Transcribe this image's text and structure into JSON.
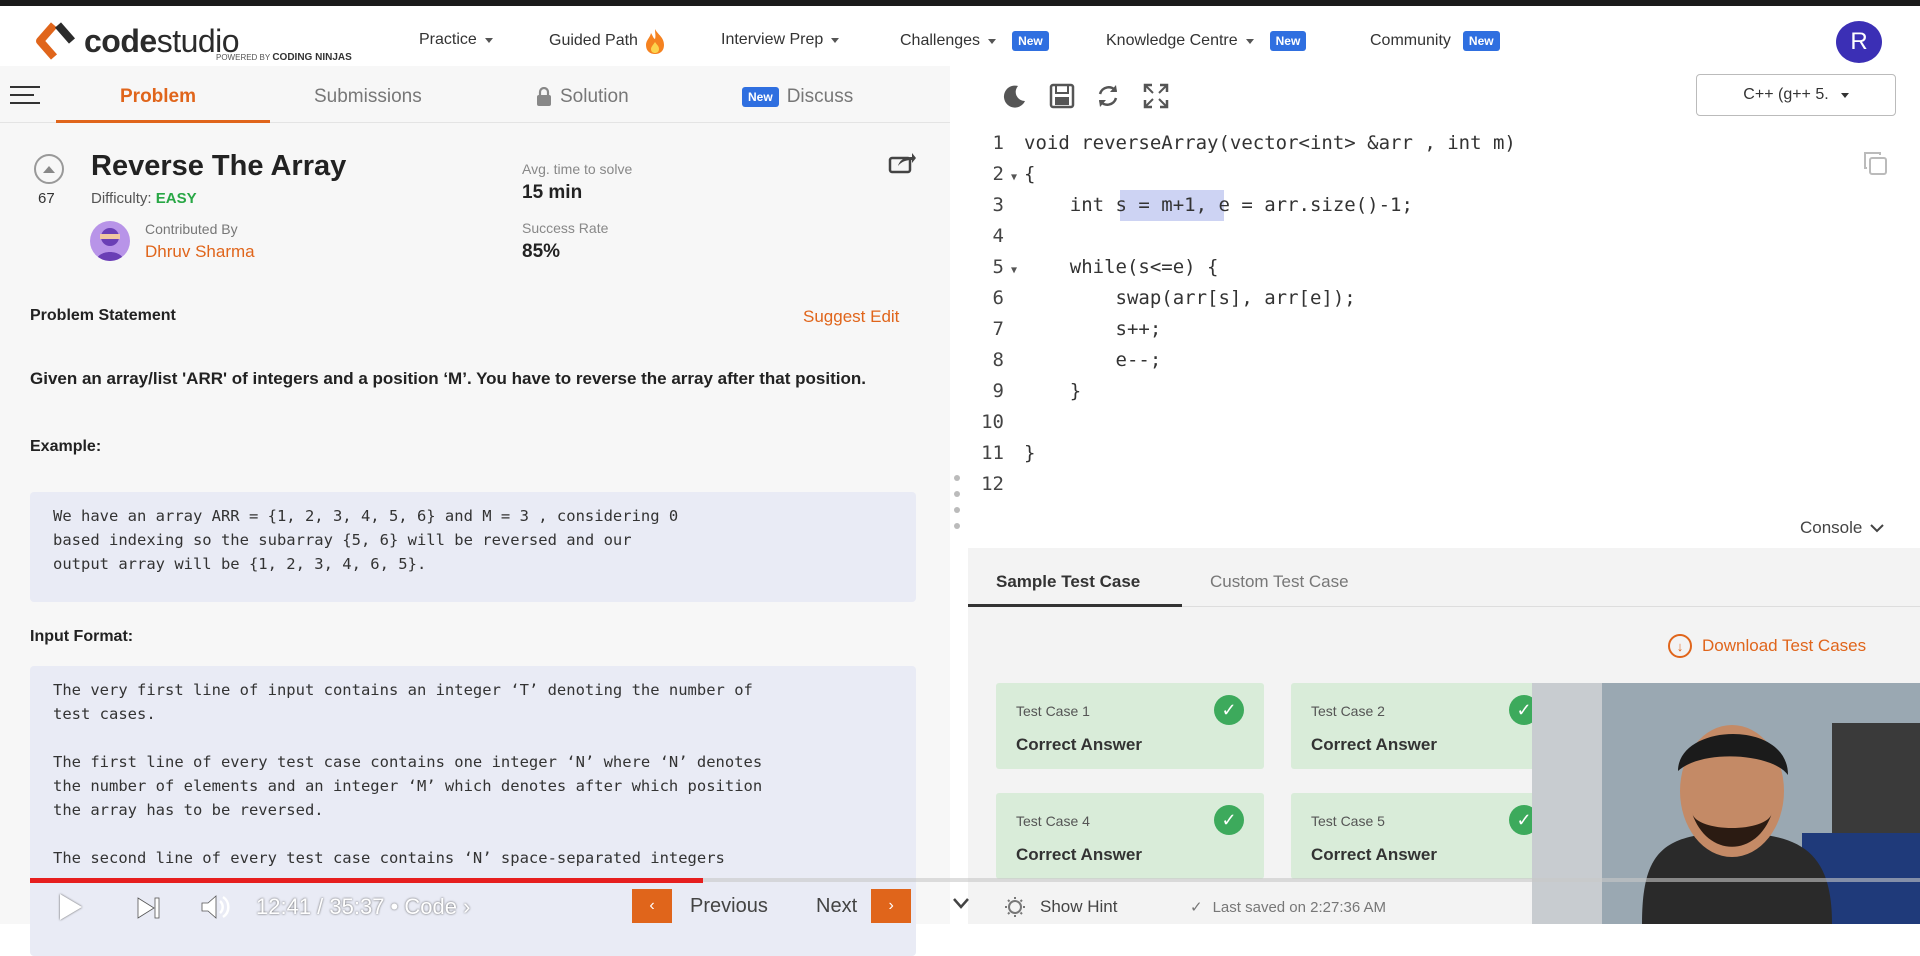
{
  "nav": {
    "logo_text_code": "code",
    "logo_text_studio": "studio",
    "powered_by": "POWERED BY",
    "coding_ninjas": "CODING NINJAS",
    "items": [
      {
        "label": "Practice"
      },
      {
        "label": "Guided Path"
      },
      {
        "label": "Interview Prep"
      },
      {
        "label": "Challenges",
        "badge": "New"
      },
      {
        "label": "Knowledge Centre",
        "badge": "New"
      },
      {
        "label": "Community",
        "badge": "New"
      }
    ],
    "avatar_initial": "R"
  },
  "problem_tabs": {
    "problem": "Problem",
    "submissions": "Submissions",
    "solution": "Solution",
    "discuss_badge": "New",
    "discuss": "Discuss"
  },
  "problem": {
    "upvotes": "67",
    "title": "Reverse The Array",
    "difficulty_label": "Difficulty:",
    "difficulty": "EASY",
    "contributed_label": "Contributed By",
    "contributor": "Dhruv Sharma",
    "avg_time_label": "Avg. time to solve",
    "avg_time": "15 min",
    "success_label": "Success Rate",
    "success_rate": "85%",
    "statement_heading": "Problem Statement",
    "suggest_edit": "Suggest Edit",
    "statement": "Given an array/list 'ARR' of integers and a position ‘M’. You have to reverse the array after that position.",
    "example_heading": "Example:",
    "example_text": "We have an array ARR = {1, 2, 3, 4, 5, 6} and M = 3 , considering 0\nbased indexing so the subarray {5, 6} will be reversed and our\noutput array will be {1, 2, 3, 4, 6, 5}.",
    "input_heading": "Input Format:",
    "input_text": "The very first line of input contains an integer ‘T’ denoting the number of\ntest cases.\n\nThe first line of every test case contains one integer ‘N’ where ‘N’ denotes\nthe number of elements and an integer ‘M’ which denotes after which position\nthe array has to be reversed.\n\nThe second line of every test case contains ‘N’ space-separated integers"
  },
  "editor": {
    "language": "C++ (g++ 5.",
    "lines": [
      {
        "n": "1",
        "fold": "",
        "text": "void reverseArray(vector<int> &arr , int m)"
      },
      {
        "n": "2",
        "fold": "▼",
        "text": "{"
      },
      {
        "n": "3",
        "fold": "",
        "text": "    int s = m+1, e = arr.size()-1;"
      },
      {
        "n": "4",
        "fold": "",
        "text": ""
      },
      {
        "n": "5",
        "fold": "▼",
        "text": "    while(s<=e) {"
      },
      {
        "n": "6",
        "fold": "",
        "text": "        swap(arr[s], arr[e]);"
      },
      {
        "n": "7",
        "fold": "",
        "text": "        s++;"
      },
      {
        "n": "8",
        "fold": "",
        "text": "        e--;"
      },
      {
        "n": "9",
        "fold": "",
        "text": "    }"
      },
      {
        "n": "10",
        "fold": "",
        "text": ""
      },
      {
        "n": "11",
        "fold": "",
        "text": "}"
      },
      {
        "n": "12",
        "fold": "",
        "text": ""
      }
    ],
    "console_label": "Console"
  },
  "console": {
    "tab_sample": "Sample Test Case",
    "tab_custom": "Custom Test Case",
    "download": "Download Test Cases",
    "test_cases": [
      {
        "name": "Test Case 1",
        "result": "Correct Answer"
      },
      {
        "name": "Test Case 2",
        "result": "Correct Answer"
      },
      {
        "name": "Test Case 4",
        "result": "Correct Answer"
      },
      {
        "name": "Test Case 5",
        "result": "Correct Answer"
      }
    ]
  },
  "player": {
    "time": "12:41 / 35:37 • Code ›",
    "progress_fraction": 0.356,
    "previous": "Previous",
    "next": "Next",
    "show_hint": "Show Hint",
    "last_saved": "Last saved on 2:27:36 AM"
  },
  "colors": {
    "accent": "#e0651b",
    "badge": "#2f6fe0",
    "easy": "#28a745",
    "progress": "#e61e1e"
  }
}
